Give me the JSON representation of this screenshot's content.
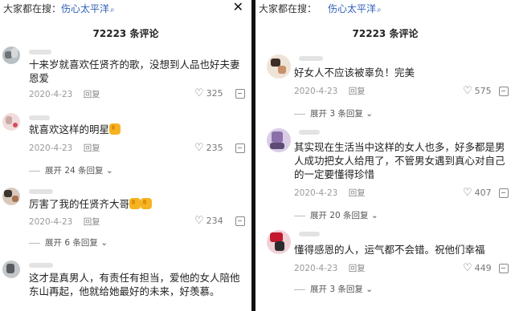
{
  "left": {
    "search_prefix": "大家都在搜：",
    "search_term": "伤心太平洋",
    "search_icon": "search-glyph",
    "close_icon": "close-x",
    "comments": [
      {
        "text": "十来岁就喜欢任贤齐的歌，没想到人品也好夫妻恩爱",
        "date": "2020-4-23",
        "reply": "回复",
        "likes": "325",
        "expand": ""
      },
      {
        "text": "就喜欢这样的明星",
        "emojis": 1,
        "date": "2020-4-23",
        "reply": "回复",
        "likes": "235",
        "expand": "展开 24 条回复"
      },
      {
        "text": "厉害了我的任贤齐大哥",
        "emojis": 2,
        "date": "2020-4-23",
        "reply": "回复",
        "likes": "234",
        "expand": "展开 6 条回复"
      },
      {
        "text": "这才是真男人，有责任有担当，爱他的女人陪他东山再起，他就给她最好的未来，好羡慕。"
      }
    ]
  },
  "right": {
    "search_prefix": "大家都在搜：",
    "search_term": "伤心太平洋",
    "search_icon": "search-glyph",
    "comment_count": "72223 条评论",
    "comments": [
      {
        "text": "好女人不应该被辜负！完美",
        "date": "2020-4-23",
        "reply": "回复",
        "likes": "575",
        "expand": "展开 3 条回复"
      },
      {
        "text": "其实现在生活当中这样的女人也多，好多都是男人成功把女人给甩了，不管男女遇到真心对自己的一定要懂得珍惜",
        "date": "2020-4-23",
        "reply": "回复",
        "likes": "407",
        "expand": "展开 20 条回复"
      },
      {
        "text": "懂得感恩的人，运气都不会错。祝他们幸福",
        "date": "2020-4-23",
        "reply": "回复",
        "likes": "449",
        "expand": "展开 3 条回复"
      }
    ]
  },
  "left_comment_count": "72223 条评论",
  "colors": {
    "search_term": "#2f5fb5",
    "text": "#222222",
    "meta": "#999999",
    "emoji": "#f5b321"
  }
}
